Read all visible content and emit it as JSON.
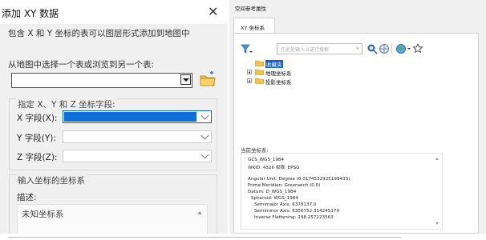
{
  "left_dialog": {
    "title": "添加 XY 数据",
    "close": "✕",
    "description": "包含 X 和 Y 坐标的表可以图层形式添加到地图中",
    "choose_table_label": "从地图中选择一个表或浏览到另一个表:",
    "table_value": "",
    "fields_group": {
      "title": "指定 X、Y 和 Z 坐标字段:",
      "x_label": "X 字段(X):",
      "y_label": "Y 字段(Y):",
      "z_label": "Z 字段(Z):",
      "x_value": "",
      "y_value": "",
      "z_value": ""
    },
    "coord_group": {
      "title": "输入坐标的坐标系",
      "description_label": "描述:",
      "description_value": "未知坐标系"
    }
  },
  "right_dialog": {
    "title": "空间参考属性",
    "tab": "XY 坐标系",
    "search_placeholder": "在此处输入以进行搜索",
    "tree": [
      {
        "label": "收藏夹",
        "selected": true,
        "expanded": false
      },
      {
        "label": "地理坐标系",
        "selected": false,
        "expanded": false
      },
      {
        "label": "投影坐标系",
        "selected": false,
        "expanded": false
      }
    ],
    "current_label": "当前坐标系:",
    "details": [
      "GCS_WGS_1984",
      "WKID: 4326 权限: EPSG",
      "",
      "Angular Unit: Degree (0.0174532925199433)",
      "Prime Meridian: Greenwich (0.0)",
      "Datum: D_WGS_1984",
      "  Spheroid: WGS_1984",
      "    Semimajor Axis: 6378137.0",
      "    Semiminor Axis: 6356752.314245179",
      "    Inverse Flattening: 298.257223563"
    ]
  },
  "colors": {
    "selection_blue": "#0f6fd6",
    "dialog_bg": "#f0f0f0"
  }
}
